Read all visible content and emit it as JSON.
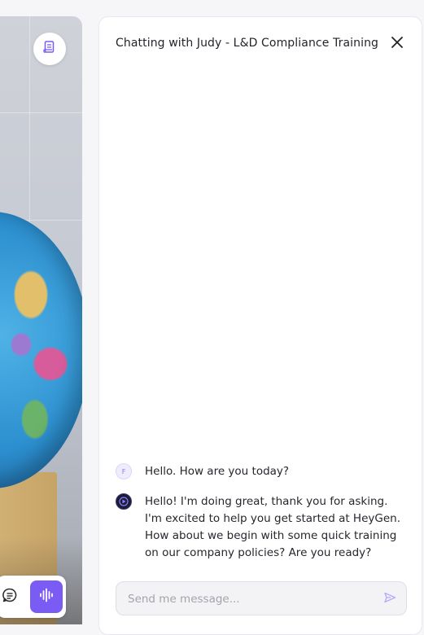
{
  "chat": {
    "title": "Chatting with Judy - L&D Compliance Training",
    "messages": [
      {
        "sender": "user",
        "avatar_initial": "F",
        "text": "Hello. How are you today?"
      },
      {
        "sender": "avatar",
        "text": "Hello! I'm doing great, thank you for asking. I'm excited to help you get started at HeyGen. How about we begin with some quick training on our company policies? Are you ready?"
      }
    ],
    "input": {
      "placeholder": "Send me message...",
      "value": ""
    }
  },
  "icons": {
    "transcript": "document-icon",
    "chat_toggle": "chat-bubble-icon",
    "voice": "audio-wave-icon",
    "close": "close-icon",
    "send": "send-icon"
  },
  "colors": {
    "accent": "#7a5cf5",
    "panel_background": "#ffffff",
    "text": "#26262d",
    "placeholder": "#a3a3ad"
  }
}
